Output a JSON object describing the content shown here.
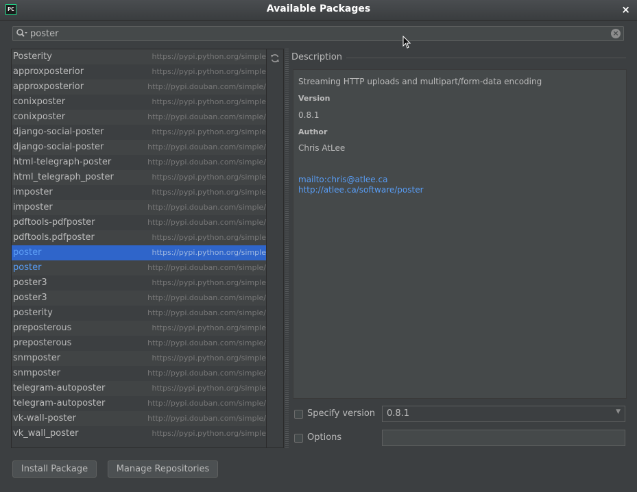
{
  "window": {
    "title": "Available Packages",
    "app_icon_text": "PC",
    "close_glyph": "×"
  },
  "search": {
    "value": "poster",
    "clear_glyph": "×"
  },
  "packages": [
    {
      "name": "Posterity",
      "repo": "https://pypi.python.org/simple"
    },
    {
      "name": "approxposterior",
      "repo": "https://pypi.python.org/simple"
    },
    {
      "name": "approxposterior",
      "repo": "http://pypi.douban.com/simple/"
    },
    {
      "name": "conixposter",
      "repo": "https://pypi.python.org/simple"
    },
    {
      "name": "conixposter",
      "repo": "http://pypi.douban.com/simple/"
    },
    {
      "name": "django-social-poster",
      "repo": "https://pypi.python.org/simple"
    },
    {
      "name": "django-social-poster",
      "repo": "http://pypi.douban.com/simple/"
    },
    {
      "name": "html-telegraph-poster",
      "repo": "http://pypi.douban.com/simple/"
    },
    {
      "name": "html_telegraph_poster",
      "repo": "https://pypi.python.org/simple"
    },
    {
      "name": "imposter",
      "repo": "https://pypi.python.org/simple"
    },
    {
      "name": "imposter",
      "repo": "http://pypi.douban.com/simple/"
    },
    {
      "name": "pdftools-pdfposter",
      "repo": "http://pypi.douban.com/simple/"
    },
    {
      "name": "pdftools.pdfposter",
      "repo": "https://pypi.python.org/simple"
    },
    {
      "name": "poster",
      "repo": "https://pypi.python.org/simple"
    },
    {
      "name": "poster",
      "repo": "http://pypi.douban.com/simple/"
    },
    {
      "name": "poster3",
      "repo": "https://pypi.python.org/simple"
    },
    {
      "name": "poster3",
      "repo": "http://pypi.douban.com/simple/"
    },
    {
      "name": "posterity",
      "repo": "http://pypi.douban.com/simple/"
    },
    {
      "name": "preposterous",
      "repo": "https://pypi.python.org/simple"
    },
    {
      "name": "preposterous",
      "repo": "http://pypi.douban.com/simple/"
    },
    {
      "name": "snmposter",
      "repo": "https://pypi.python.org/simple"
    },
    {
      "name": "snmposter",
      "repo": "http://pypi.douban.com/simple/"
    },
    {
      "name": "telegram-autoposter",
      "repo": "https://pypi.python.org/simple"
    },
    {
      "name": "telegram-autoposter",
      "repo": "http://pypi.douban.com/simple/"
    },
    {
      "name": "vk-wall-poster",
      "repo": "http://pypi.douban.com/simple/"
    },
    {
      "name": "vk_wall_poster",
      "repo": "https://pypi.python.org/simple"
    }
  ],
  "selected_index": 13,
  "installed_index": 14,
  "description": {
    "header": "Description",
    "summary": "Streaming HTTP uploads and multipart/form-data encoding",
    "version_label": "Version",
    "version": "0.8.1",
    "author_label": "Author",
    "author": "Chris AtLee",
    "email_link": "mailto:chris@atlee.ca",
    "homepage_link": "http://atlee.ca/software/poster"
  },
  "options": {
    "specify_version_label": "Specify version",
    "specify_version_value": "0.8.1",
    "options_label": "Options",
    "options_value": ""
  },
  "buttons": {
    "install": "Install Package",
    "manage": "Manage Repositories"
  },
  "colors": {
    "selection": "#2f65ca",
    "link": "#589df6",
    "background": "#3c3f41"
  }
}
